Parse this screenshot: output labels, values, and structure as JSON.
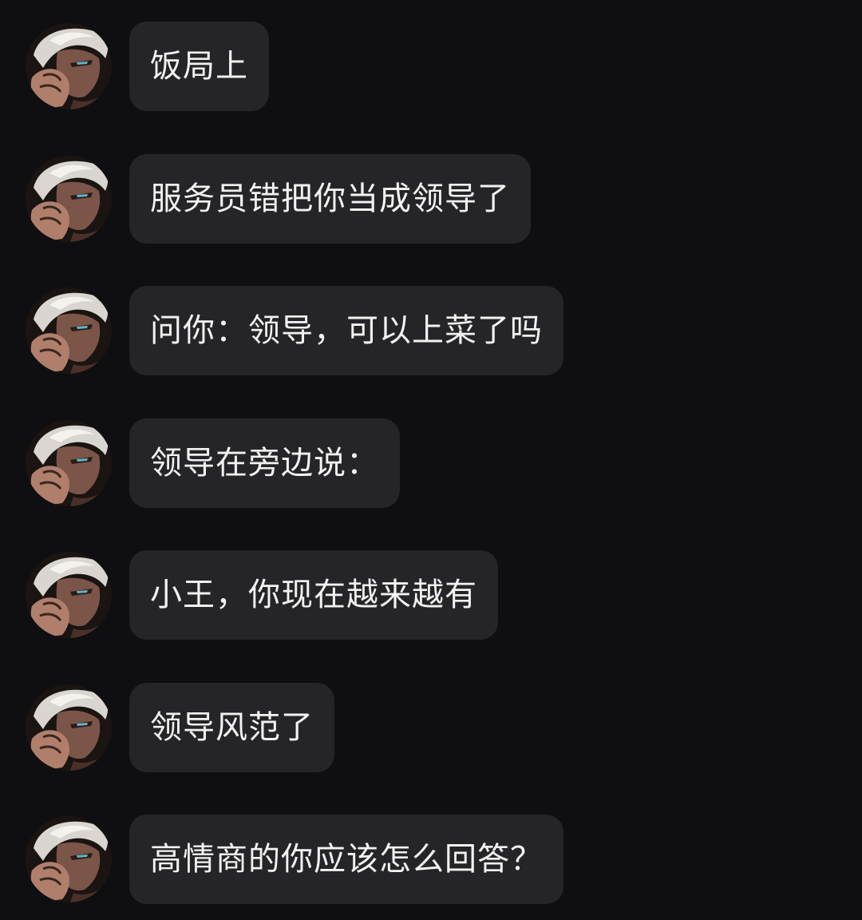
{
  "chat": {
    "messages": [
      {
        "text": "饭局上"
      },
      {
        "text": "服务员错把你当成领导了"
      },
      {
        "text": "问你：领导，可以上菜了吗"
      },
      {
        "text": "领导在旁边说："
      },
      {
        "text": "小王，你现在越来越有"
      },
      {
        "text": "领导风范了"
      },
      {
        "text": "高情商的你应该怎么回答？"
      }
    ],
    "avatar_icon": "user-avatar-manga-portrait",
    "colors": {
      "background": "#0f0f11",
      "bubble": "#252528",
      "text": "#f2f2f2"
    }
  }
}
